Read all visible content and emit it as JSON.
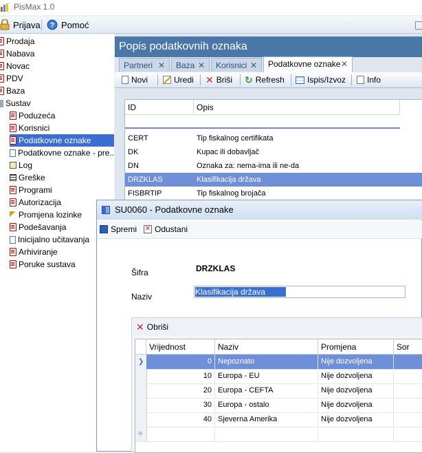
{
  "app": {
    "title": "PisMax 1.0"
  },
  "menu": {
    "prijava": "Prijava",
    "pomoc": "Pomoć"
  },
  "tree": [
    {
      "label": "Prodaja",
      "level": 0
    },
    {
      "label": "Nabava",
      "level": 0
    },
    {
      "label": "Novac",
      "level": 0
    },
    {
      "label": "PDV",
      "level": 0
    },
    {
      "label": "Baza",
      "level": 0
    },
    {
      "label": "Sustav",
      "level": 0
    },
    {
      "label": "Poduzeća",
      "level": 1
    },
    {
      "label": "Korisnici",
      "level": 1
    },
    {
      "label": "Podatkovne oznake",
      "level": 1,
      "selected": true
    },
    {
      "label": "Podatkovne oznake - pre...",
      "level": 1
    },
    {
      "label": "Log",
      "level": 1
    },
    {
      "label": "Greške",
      "level": 1
    },
    {
      "label": "Programi",
      "level": 1
    },
    {
      "label": "Autorizacija",
      "level": 1
    },
    {
      "label": "Promjena lozinke",
      "level": 1
    },
    {
      "label": "Podešavanja",
      "level": 1
    },
    {
      "label": "Inicijalno učitavanja",
      "level": 1
    },
    {
      "label": "Arhiviranje",
      "level": 1
    },
    {
      "label": "Poruke sustava",
      "level": 1
    }
  ],
  "panel": {
    "title": "Popis podatkovnih oznaka",
    "tabs": [
      "Partneri",
      "Baza",
      "Korisnici",
      "Podatkovne oznake"
    ],
    "toolbar": {
      "novi": "Novi",
      "uredi": "Uredi",
      "brisi": "Briši",
      "refresh": "Refresh",
      "ispis": "Ispis/Izvoz",
      "info": "Info"
    },
    "grid": {
      "headers": [
        "ID",
        "Opis"
      ],
      "rows": [
        {
          "id": "CERT",
          "opis": "Tip fiskalnog certifikata"
        },
        {
          "id": "DK",
          "opis": "Kupac ili dobavljač"
        },
        {
          "id": "DN",
          "opis": "Oznaka za: nema-ima ili ne-da"
        },
        {
          "id": "DRZKLAS",
          "opis": "Klasifikacija država",
          "selected": true
        },
        {
          "id": "FISBRTIP",
          "opis": "Tip fiskalnog brojača"
        }
      ]
    }
  },
  "dialog": {
    "title": "SU0060 - Podatkovne oznake",
    "spremi": "Spremi",
    "odustani": "Odustani",
    "sifra_label": "Šifra",
    "sifra_value": "DRZKLAS",
    "naziv_label": "Naziv",
    "naziv_value": "Klasifikacija država",
    "obrisi": "Obriši",
    "table": {
      "headers": [
        "Vrijednost",
        "Naziv",
        "Promjena",
        "Sor"
      ],
      "rows": [
        {
          "vrijednost": "0",
          "naziv": "Nepoznato",
          "promjena": "Nije dozvoljena",
          "selected": true
        },
        {
          "vrijednost": "10",
          "naziv": "Europa - EU",
          "promjena": "Nije dozvoljena"
        },
        {
          "vrijednost": "20",
          "naziv": "Europa - CEFTA",
          "promjena": "Nije dozvoljena"
        },
        {
          "vrijednost": "30",
          "naziv": "Europa - ostalo",
          "promjena": "Nije dozvoljena"
        },
        {
          "vrijednost": "40",
          "naziv": "Sjeverna Amerika",
          "promjena": "Nije dozvoljena"
        }
      ]
    }
  },
  "colors": {
    "accent": "#3a6fd1",
    "panel_title": "#4a76a8",
    "grid_selected": "#6f8fd8"
  }
}
